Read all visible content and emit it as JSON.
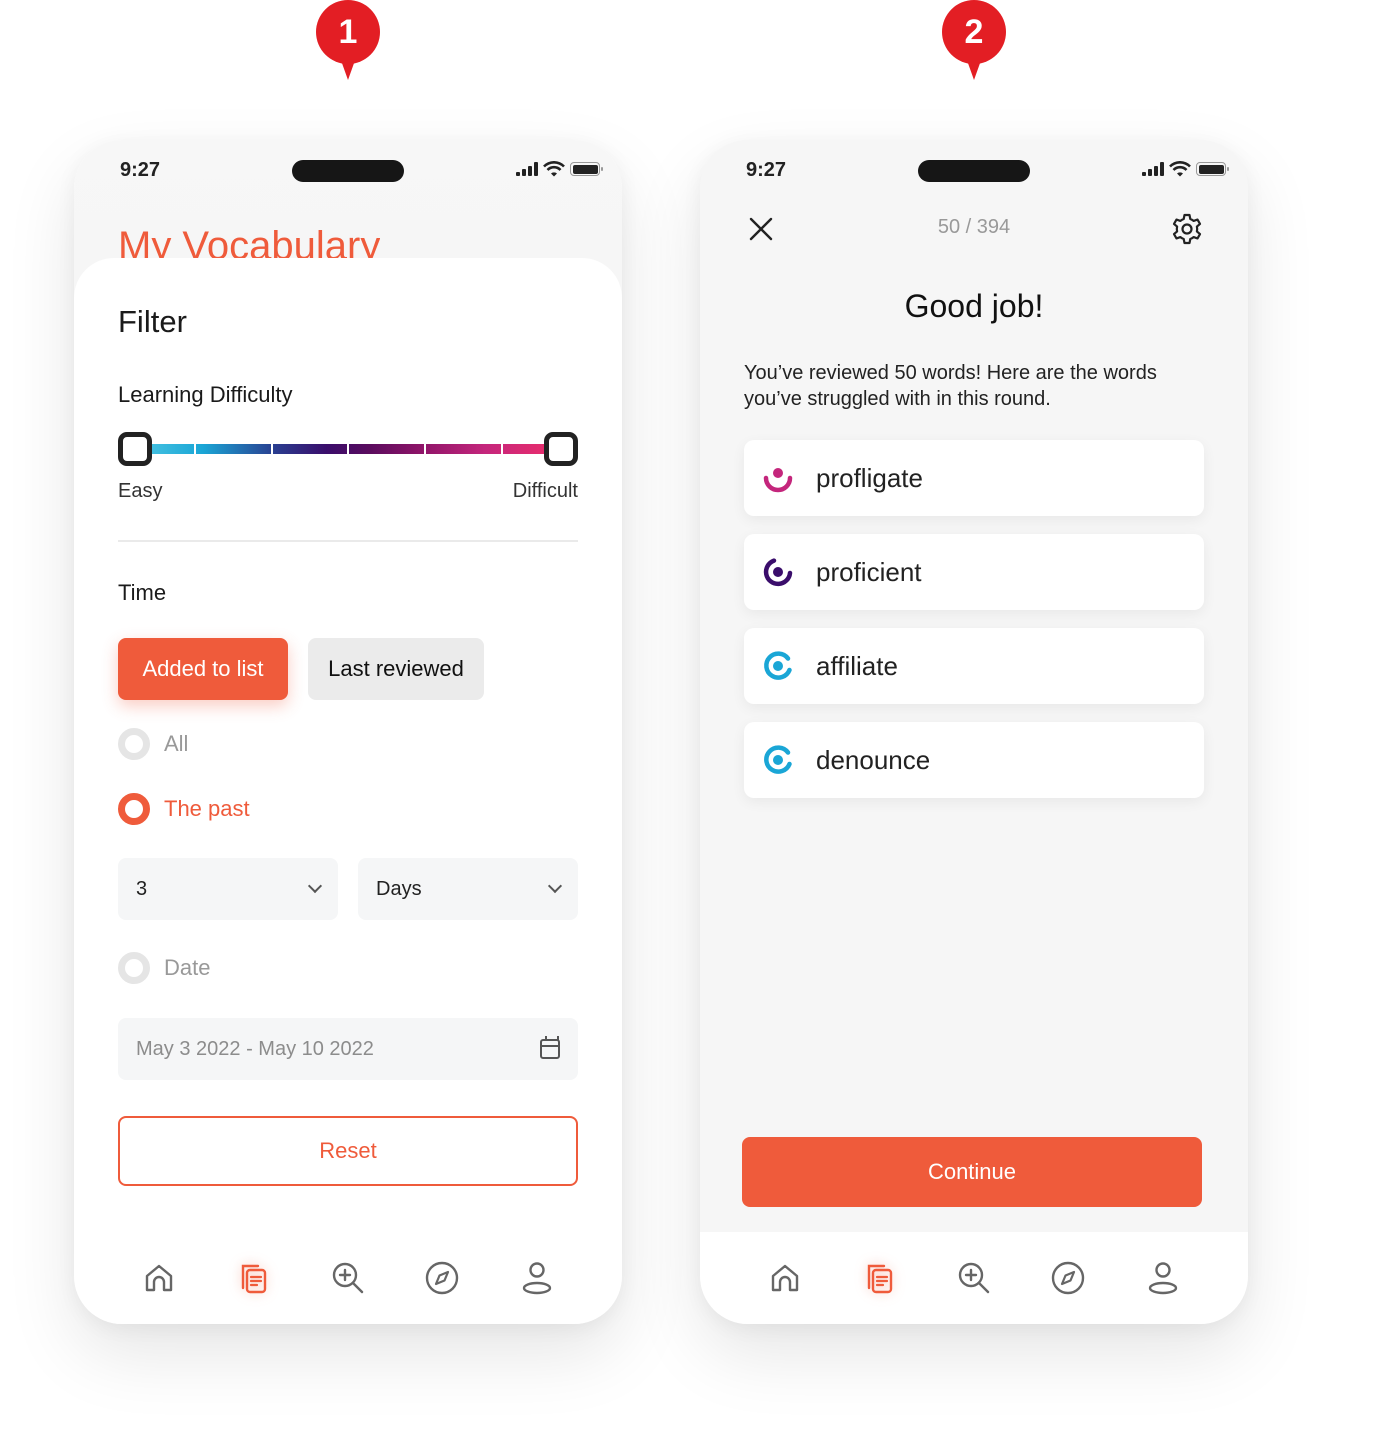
{
  "pins": [
    {
      "label": "1"
    },
    {
      "label": "2"
    }
  ],
  "colors": {
    "accent": "#ef5b3b",
    "pin": "#e31e24",
    "level_easy": "#1aa6d6",
    "level_mid": "#3a0d6b",
    "level_hard": "#c4267c"
  },
  "status_bar": {
    "time": "9:27"
  },
  "screen1": {
    "background_title": "My Vocabulary",
    "filter": {
      "title": "Filter",
      "difficulty": {
        "label": "Learning Difficulty",
        "min_label": "Easy",
        "max_label": "Difficult",
        "range_start": 0.0,
        "range_end": 1.0
      },
      "time": {
        "label": "Time",
        "segments": [
          {
            "label": "Added to list",
            "active": true
          },
          {
            "label": "Last reviewed",
            "active": false
          }
        ],
        "options": [
          {
            "label": "All",
            "selected": false
          },
          {
            "label": "The past",
            "selected": true
          },
          {
            "label": "Date",
            "selected": false
          }
        ],
        "past_amount": "3",
        "past_unit": "Days",
        "date_range": "May 3 2022 - May 10 2022"
      },
      "reset_label": "Reset"
    }
  },
  "screen2": {
    "progress": "50 / 394",
    "title": "Good job!",
    "message": "You’ve reviewed 50 words! Here are the words you’ve struggled with in this round.",
    "words": [
      {
        "word": "profligate",
        "level_icon": "difficulty-hard-icon",
        "color": "#c4267c"
      },
      {
        "word": "proficient",
        "level_icon": "difficulty-medium-icon",
        "color": "#3a0d6b"
      },
      {
        "word": "affiliate",
        "level_icon": "difficulty-easy-icon",
        "color": "#1aa6d6"
      },
      {
        "word": "denounce",
        "level_icon": "difficulty-easy-icon",
        "color": "#1aa6d6"
      }
    ],
    "continue_label": "Continue"
  },
  "tabbar": [
    {
      "name": "home",
      "icon": "home-icon",
      "active": false
    },
    {
      "name": "vocabulary",
      "icon": "vocabulary-cards-icon",
      "active": true
    },
    {
      "name": "search",
      "icon": "zoom-in-search-icon",
      "active": false
    },
    {
      "name": "explore",
      "icon": "compass-icon",
      "active": false
    },
    {
      "name": "profile",
      "icon": "profile-icon",
      "active": false
    }
  ]
}
